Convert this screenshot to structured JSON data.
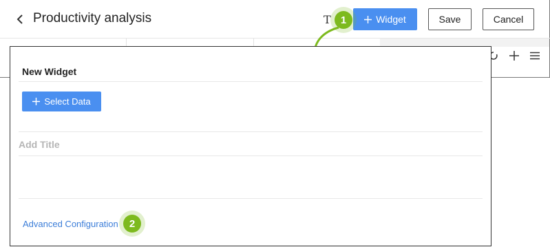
{
  "header": {
    "title": "Productivity analysis",
    "text_tool_glyph": "T",
    "widget_button_label": "Widget",
    "save_label": "Save",
    "cancel_label": "Cancel"
  },
  "icons": {
    "back": "chevron-left-icon",
    "plus": "plus-icon",
    "refresh": "refresh-icon",
    "menu": "menu-icon"
  },
  "callouts": {
    "one": "1",
    "two": "2"
  },
  "modal": {
    "title": "New Widget",
    "select_data_label": "Select Data",
    "title_placeholder": "Add Title",
    "advanced_link": "Advanced Configuration"
  },
  "colors": {
    "primary": "#4a8ff0",
    "callout": "#7dba1e",
    "link": "#3b7dd8",
    "placeholder": "#b5b5b5"
  }
}
